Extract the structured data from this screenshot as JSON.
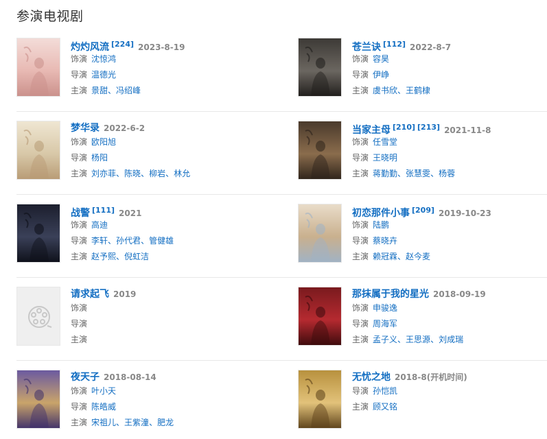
{
  "page_title": "参演电视剧",
  "labels": {
    "role": "饰演",
    "director": "导演",
    "cast": "主演"
  },
  "dramas": [
    {
      "title": "灼灼风流",
      "sups": [
        "[224]"
      ],
      "date": "2023-8-19",
      "role": "沈惊鸿",
      "director": [
        "温德光"
      ],
      "cast": [
        "景甜",
        "冯绍峰"
      ],
      "colors": [
        "#f3dcd8",
        "#e8b9b3",
        "#c98f8a"
      ]
    },
    {
      "title": "苍兰诀",
      "sups": [
        "[112]"
      ],
      "date": "2022-8-7",
      "role": "容昊",
      "director": [
        "伊峥"
      ],
      "cast": [
        "虞书欣",
        "王鹤棣"
      ],
      "colors": [
        "#3d3a36",
        "#6b6660",
        "#1e1c1a"
      ]
    },
    {
      "title": "梦华录",
      "sups": [],
      "date": "2022-6-2",
      "role": "欧阳旭",
      "director": [
        "杨阳"
      ],
      "cast": [
        "刘亦菲",
        "陈晓",
        "柳岩",
        "林允"
      ],
      "colors": [
        "#efe6d2",
        "#d8c8a8",
        "#b79a74"
      ]
    },
    {
      "title": "当家主母",
      "sups": [
        "[210]",
        "[213]"
      ],
      "date": "2021-11-8",
      "role": "任雪堂",
      "director": [
        "王晓明"
      ],
      "cast": [
        "蒋勤勤",
        "张慧雯",
        "杨蓉"
      ],
      "colors": [
        "#4a3a2c",
        "#8a6c4c",
        "#2c221a"
      ]
    },
    {
      "title": "战警",
      "sups": [
        "[111]"
      ],
      "date": "2021",
      "role": "高迪",
      "director": [
        "李轩",
        "孙代君",
        "管健雄"
      ],
      "cast": [
        "赵予熙",
        "倪虹洁"
      ],
      "colors": [
        "#1c1f2e",
        "#3a4058",
        "#0d0f18"
      ]
    },
    {
      "title": "初恋那件小事",
      "sups": [
        "[209]"
      ],
      "date": "2019-10-23",
      "role": "陆鹏",
      "director": [
        "蔡晓卉"
      ],
      "cast": [
        "赖冠霖",
        "赵今麦"
      ],
      "colors": [
        "#e9dcc9",
        "#c9b08e",
        "#9fb2c6"
      ]
    },
    {
      "title": "请求起飞",
      "sups": [],
      "date": "2019",
      "role": "",
      "director": [],
      "cast": [],
      "colors": [
        "#efefef",
        "#efefef",
        "#efefef"
      ]
    },
    {
      "title": "那抹属于我的星光",
      "sups": [],
      "date": "2018-09-19",
      "role": "申骏逸",
      "director": [
        "周海军"
      ],
      "cast": [
        "孟子义",
        "王思源",
        "刘成瑞"
      ],
      "colors": [
        "#7a1a1e",
        "#b52a30",
        "#3a0a0c"
      ]
    },
    {
      "title": "夜天子",
      "sups": [],
      "date": "2018-08-14",
      "role": "叶小天",
      "director": [
        "陈皓威"
      ],
      "cast": [
        "宋祖儿",
        "王紫潼",
        "肥龙"
      ],
      "colors": [
        "#6b5aa0",
        "#c9a46a",
        "#3e2f6a"
      ]
    },
    {
      "title": "无忧之地",
      "sups": [],
      "date": "2018-8(开机时间)",
      "role": null,
      "director": [
        "孙恺凯"
      ],
      "cast": [
        "顾又铭"
      ],
      "colors": [
        "#b8913e",
        "#e2c27a",
        "#5a3f18"
      ]
    }
  ]
}
